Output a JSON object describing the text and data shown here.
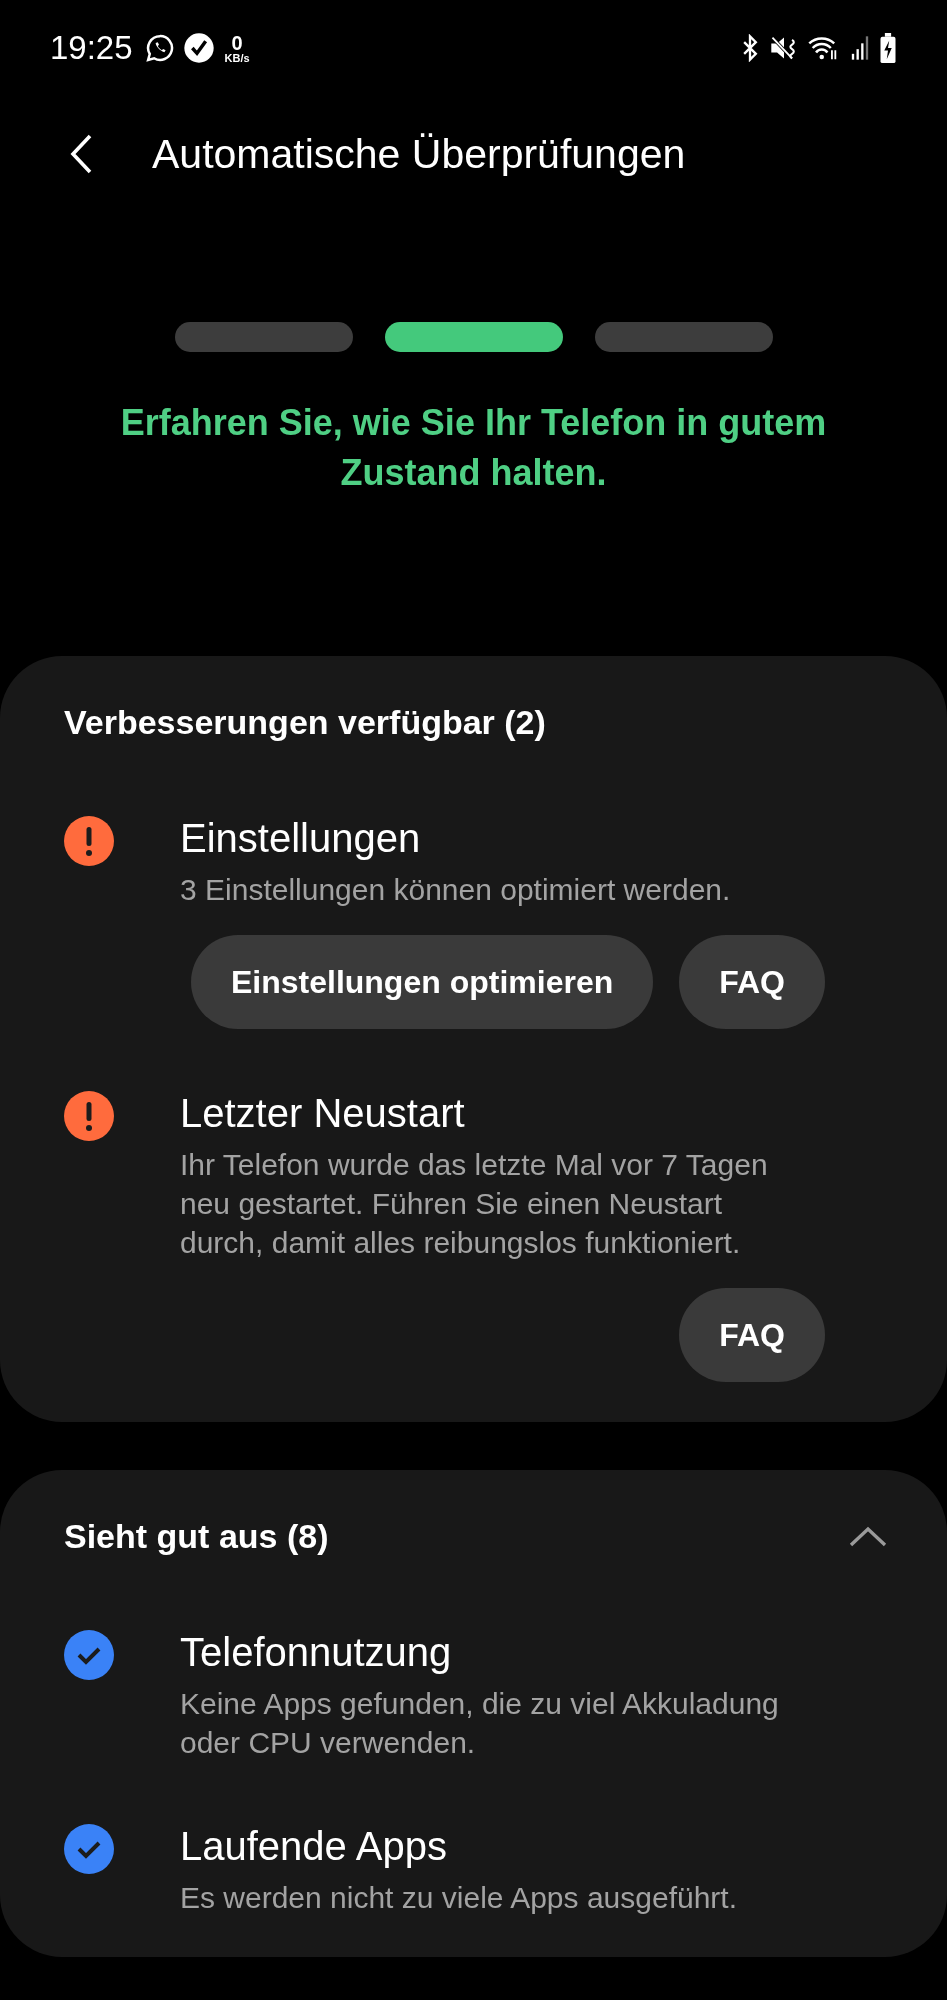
{
  "status_bar": {
    "time": "19:25",
    "data_speed": {
      "value": "0",
      "unit": "KB/s"
    }
  },
  "header": {
    "title": "Automatische Überprüfungen"
  },
  "steps": [
    {
      "selected": false
    },
    {
      "selected": true
    },
    {
      "selected": false
    }
  ],
  "intro": "Erfahren Sie, wie Sie Ihr Telefon in gutem Zustand halten.",
  "sections": [
    {
      "title": "Verbesserungen verfügbar (2)",
      "items": [
        {
          "kind": "warning",
          "title": "Einstellungen",
          "description": "3 Einstellungen können optimiert werden.",
          "buttons": [
            "Einstellungen optimieren",
            "FAQ"
          ]
        },
        {
          "kind": "warning",
          "title": "Letzter Neustart",
          "description": "Ihr Telefon wurde das letzte Mal vor 7 Tagen neu gestartet. Führen Sie einen Neustart durch, damit alles reibungslos funktioniert.",
          "buttons": [
            "FAQ"
          ]
        }
      ]
    },
    {
      "title": "Sieht gut aus (8)",
      "expanded": true,
      "items": [
        {
          "kind": "ok",
          "title": "Telefonnutzung",
          "description": "Keine Apps gefunden, die zu viel Akkuladung oder CPU verwenden."
        },
        {
          "kind": "ok",
          "title": "Laufende Apps",
          "description": "Es werden nicht zu viele Apps ausgeführt."
        }
      ]
    }
  ]
}
